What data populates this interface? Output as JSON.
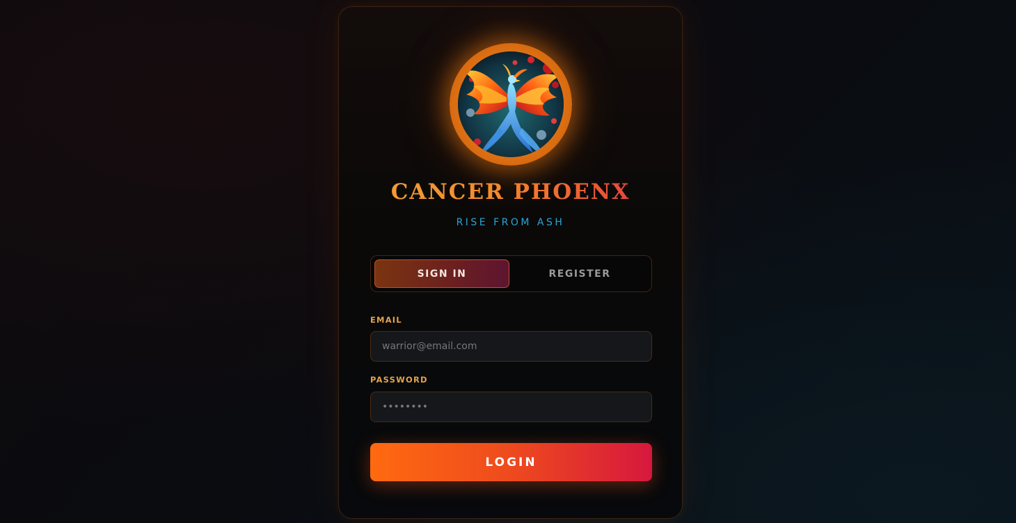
{
  "brand": {
    "title": "CANCER PHOENX",
    "tagline": "RISE FROM ASH",
    "logo_icon": "phoenix-emblem-icon"
  },
  "tabs": [
    {
      "label": "SIGN IN",
      "active": true
    },
    {
      "label": "REGISTER",
      "active": false
    }
  ],
  "form": {
    "email": {
      "label": "EMAIL",
      "placeholder": "warrior@email.com",
      "value": ""
    },
    "password": {
      "label": "PASSWORD",
      "placeholder": "••••••••",
      "value": ""
    },
    "submit_label": "LOGIN"
  },
  "colors": {
    "accent_orange": "#ff6a10",
    "accent_crimson": "#d6183e",
    "tagline_blue": "#2aa4d8",
    "label_gold": "#e2a24c"
  }
}
